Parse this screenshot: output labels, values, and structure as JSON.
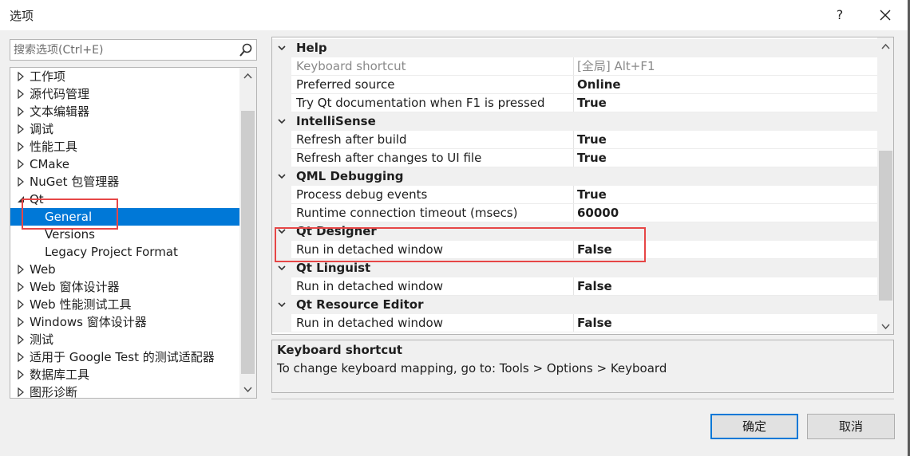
{
  "window": {
    "title": "选项",
    "help_label": "?"
  },
  "search": {
    "placeholder": "搜索选项(Ctrl+E)"
  },
  "tree": {
    "items": [
      {
        "label": "工作项",
        "expanded": false
      },
      {
        "label": "源代码管理",
        "expanded": false
      },
      {
        "label": "文本编辑器",
        "expanded": false
      },
      {
        "label": "调试",
        "expanded": false
      },
      {
        "label": "性能工具",
        "expanded": false
      },
      {
        "label": "CMake",
        "expanded": false
      },
      {
        "label": "NuGet 包管理器",
        "expanded": false
      },
      {
        "label": "Qt",
        "expanded": true
      },
      {
        "label": "General",
        "selected": true
      },
      {
        "label": "Versions"
      },
      {
        "label": "Legacy Project Format"
      },
      {
        "label": "Web",
        "expanded": false
      },
      {
        "label": "Web 窗体设计器",
        "expanded": false
      },
      {
        "label": "Web 性能测试工具",
        "expanded": false
      },
      {
        "label": "Windows 窗体设计器",
        "expanded": false
      },
      {
        "label": "测试",
        "expanded": false
      },
      {
        "label": "适用于 Google Test 的测试适配器",
        "expanded": false
      },
      {
        "label": "数据库工具",
        "expanded": false
      },
      {
        "label": "图形诊断",
        "expanded": false
      }
    ]
  },
  "grid": {
    "categories": [
      {
        "name": "Help",
        "props": [
          {
            "name": "Keyboard shortcut",
            "value": "[全局] Alt+F1",
            "readonly": true
          },
          {
            "name": "Preferred source",
            "value": "Online"
          },
          {
            "name": "Try Qt documentation when F1 is pressed",
            "value": "True"
          }
        ]
      },
      {
        "name": "IntelliSense",
        "props": [
          {
            "name": "Refresh after build",
            "value": "True"
          },
          {
            "name": "Refresh after changes to UI file",
            "value": "True"
          }
        ]
      },
      {
        "name": "QML Debugging",
        "props": [
          {
            "name": "Process debug events",
            "value": "True"
          },
          {
            "name": "Runtime connection timeout (msecs)",
            "value": "60000"
          }
        ]
      },
      {
        "name": "Qt Designer",
        "props": [
          {
            "name": "Run in detached window",
            "value": "False"
          }
        ]
      },
      {
        "name": "Qt Linguist",
        "props": [
          {
            "name": "Run in detached window",
            "value": "False"
          }
        ]
      },
      {
        "name": "Qt Resource Editor",
        "props": [
          {
            "name": "Run in detached window",
            "value": "False"
          }
        ]
      }
    ]
  },
  "description": {
    "title": "Keyboard shortcut",
    "text": "To change keyboard mapping, go to: Tools > Options > Keyboard"
  },
  "buttons": {
    "ok": "确定",
    "cancel": "取消"
  },
  "colors": {
    "selection": "#0078d7",
    "highlight_box": "#e64646"
  }
}
